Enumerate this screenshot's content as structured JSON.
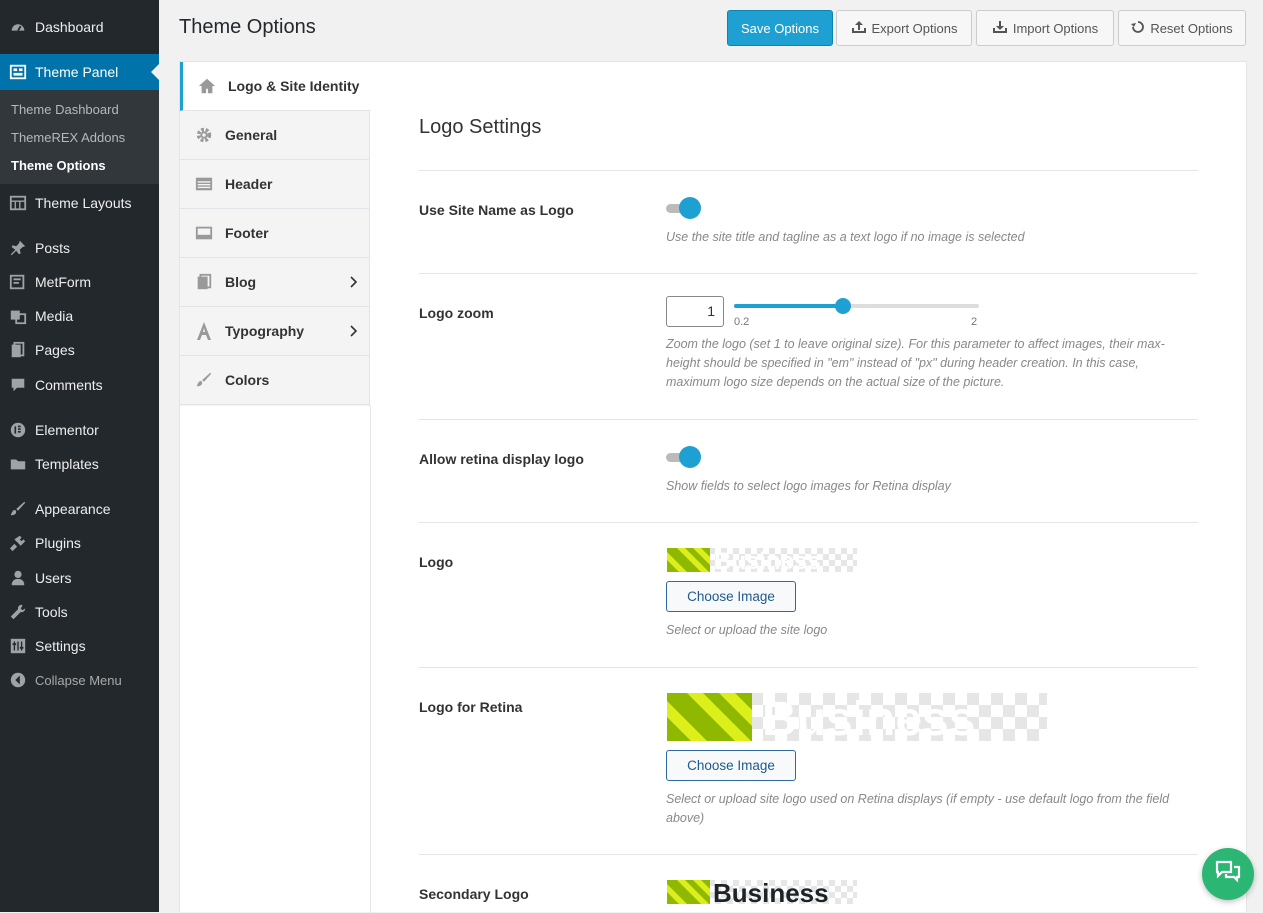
{
  "sidebar": {
    "items": [
      {
        "label": "Dashboard",
        "icon": "dashboard-icon"
      },
      {
        "label": "Theme Panel",
        "icon": "theme-panel-icon"
      },
      {
        "label": "Theme Layouts",
        "icon": "layouts-icon"
      },
      {
        "label": "Posts",
        "icon": "pin-icon"
      },
      {
        "label": "MetForm",
        "icon": "form-icon"
      },
      {
        "label": "Media",
        "icon": "media-icon"
      },
      {
        "label": "Pages",
        "icon": "pages-icon"
      },
      {
        "label": "Comments",
        "icon": "comment-icon"
      },
      {
        "label": "Elementor",
        "icon": "elementor-icon"
      },
      {
        "label": "Templates",
        "icon": "folder-icon"
      },
      {
        "label": "Appearance",
        "icon": "brush-icon"
      },
      {
        "label": "Plugins",
        "icon": "plug-icon"
      },
      {
        "label": "Users",
        "icon": "user-icon"
      },
      {
        "label": "Tools",
        "icon": "wrench-icon"
      },
      {
        "label": "Settings",
        "icon": "settings-icon"
      }
    ],
    "submenu": [
      "Theme Dashboard",
      "ThemeREX Addons",
      "Theme Options"
    ],
    "collapse_label": "Collapse Menu"
  },
  "header": {
    "title": "Theme Options",
    "buttons": {
      "save": "Save Options",
      "export": "Export Options",
      "import": "Import Options",
      "reset": "Reset Options"
    }
  },
  "tabs": [
    {
      "label": "Logo & Site Identity",
      "icon": "home-icon"
    },
    {
      "label": "General",
      "icon": "gear-icon"
    },
    {
      "label": "Header",
      "icon": "header-icon"
    },
    {
      "label": "Footer",
      "icon": "footer-icon"
    },
    {
      "label": "Blog",
      "icon": "blog-icon"
    },
    {
      "label": "Typography",
      "icon": "typography-icon"
    },
    {
      "label": "Colors",
      "icon": "brush-icon"
    }
  ],
  "section": {
    "title": "Logo Settings",
    "options": {
      "site_name": {
        "label": "Use Site Name as Logo",
        "enabled": true,
        "desc": "Use the site title and tagline as a text logo if no image is selected"
      },
      "zoom": {
        "label": "Logo zoom",
        "value": "1",
        "min_label": "0.2",
        "max_label": "2",
        "min": 0.2,
        "max": 2,
        "current": 1,
        "desc": "Zoom the logo (set 1 to leave original size). For this parameter to affect images, their max-height should be specified in \"em\" instead of \"px\" during header creation. In this case, maximum logo size depends on the actual size of the picture."
      },
      "retina": {
        "label": "Allow retina display logo",
        "enabled": true,
        "desc": "Show fields to select logo images for Retina display"
      },
      "logo": {
        "label": "Logo",
        "image_text": "Business",
        "button": "Choose Image",
        "desc": "Select or upload the site logo"
      },
      "logo_retina": {
        "label": "Logo for Retina",
        "image_text": "Business",
        "button": "Choose Image",
        "desc": "Select or upload site logo used on Retina displays (if empty - use default logo from the field above)"
      },
      "secondary_logo": {
        "label": "Secondary Logo",
        "image_text": "Business"
      }
    }
  },
  "colors": {
    "accent": "#1ea0d3",
    "sidebar_bg": "#23282d",
    "sidebar_active": "#0073aa",
    "logo_green": "#8fb800",
    "chat": "#2bb673"
  }
}
